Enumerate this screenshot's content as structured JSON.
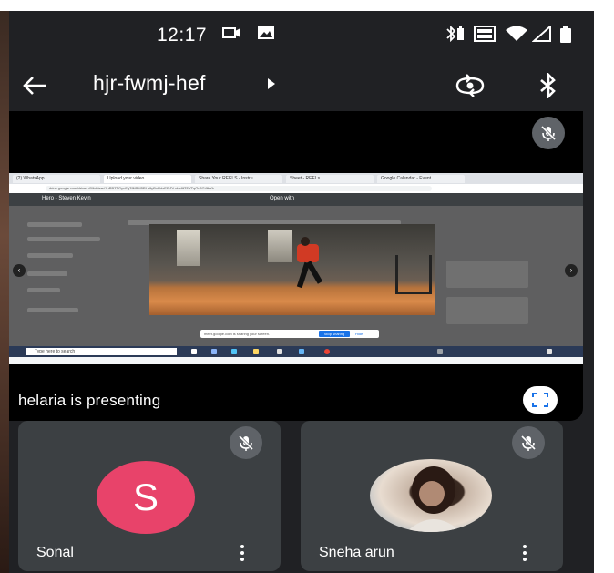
{
  "status_bar": {
    "time": "12:17",
    "icons": [
      "screen-record-icon",
      "image-icon",
      "bluetooth-battery-icon",
      "volte-icon",
      "wifi-icon",
      "signal-icon",
      "battery-icon"
    ]
  },
  "header": {
    "meeting_code": "hjr-fwmj-hef",
    "icons": [
      "back-arrow-icon",
      "caret-right-icon",
      "switch-camera-icon",
      "bluetooth-icon"
    ]
  },
  "presentation": {
    "presenter_text": "helaria is presenting",
    "screen": {
      "tabs": [
        "(2) WhatsApp",
        "Upload your video",
        "Share Your REELS - Instru",
        "Sheet - REELs",
        "Google Calendar - Event"
      ],
      "address": "drive.google.com/drive/u/0/folders/1uRBZTGyuFqZfNRM5RLz9yBuRdxEFrDLvHx9fZFYTqGrRG4fbYk",
      "drive_title": "Hero - Steven Kevin",
      "open_with": "Open with",
      "share_notice": "meet.google.com is sharing your screen.",
      "stop_sharing": "Stop sharing",
      "hide": "Hide",
      "taskbar_search": "Type here to search"
    },
    "colors": {
      "background": "#000000",
      "mute_badge": "#5f6368"
    }
  },
  "participants": [
    {
      "name": "Sonal",
      "avatar_letter": "S",
      "avatar_color": "#e8436a",
      "muted": true
    },
    {
      "name": "Sneha arun",
      "avatar_letter": "",
      "avatar_color": "",
      "muted": true
    }
  ],
  "colors": {
    "app_background": "#202124",
    "tile_background": "#3c4043"
  }
}
